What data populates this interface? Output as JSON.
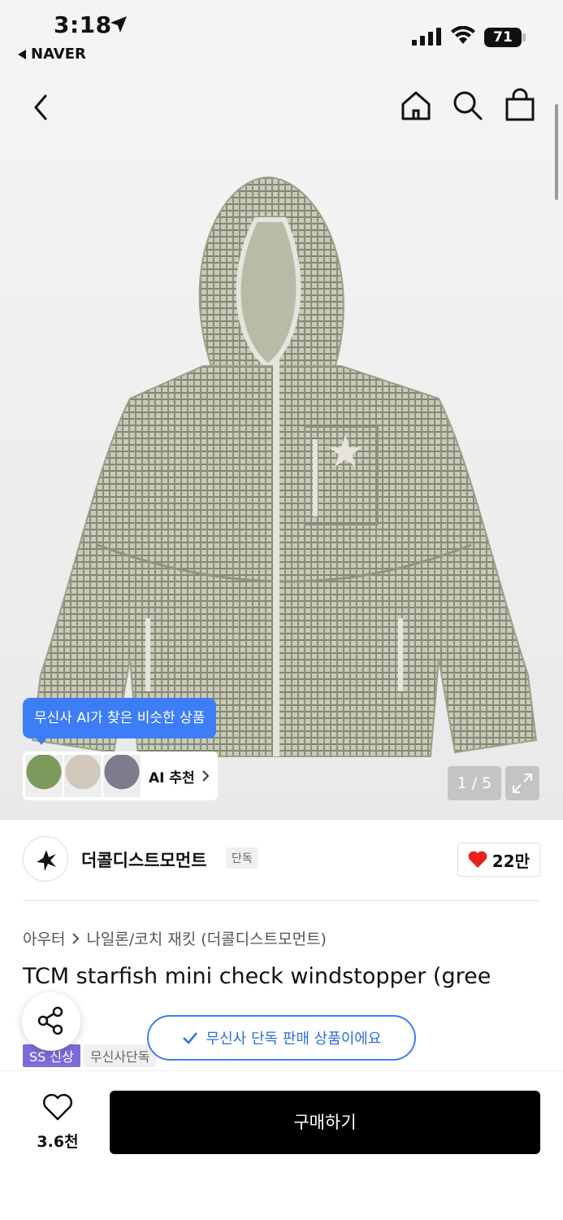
{
  "status_bar": {
    "time": "3:18",
    "back_app": "NAVER",
    "battery": "71"
  },
  "product_image": {
    "ai_bubble_text": "무신사 AI가 찾은 비슷한 상품",
    "ai_recommend_label": "AI 추천",
    "counter": "1 / 5"
  },
  "brand": {
    "name": "더콜디스트모먼트",
    "exclusive_tag": "단독",
    "like_count": "22만"
  },
  "breadcrumb": {
    "category": "아우터",
    "subcategory": "나일론/코치 재킷 (더콜디스트모먼트)"
  },
  "product": {
    "title": "TCM starfish mini check windstopper (gree",
    "tags": [
      "SS 신상",
      "무신사단독"
    ]
  },
  "toast": {
    "text": "무신사 단독 판매 상품이에요"
  },
  "bottom_bar": {
    "wish_count": "3.6천",
    "buy_label": "구매하기"
  },
  "colors": {
    "accent_blue": "#3d7df6",
    "heart_red": "#e8231e",
    "new_tag_purple": "#7b6dd8",
    "buy_button": "#000000"
  }
}
